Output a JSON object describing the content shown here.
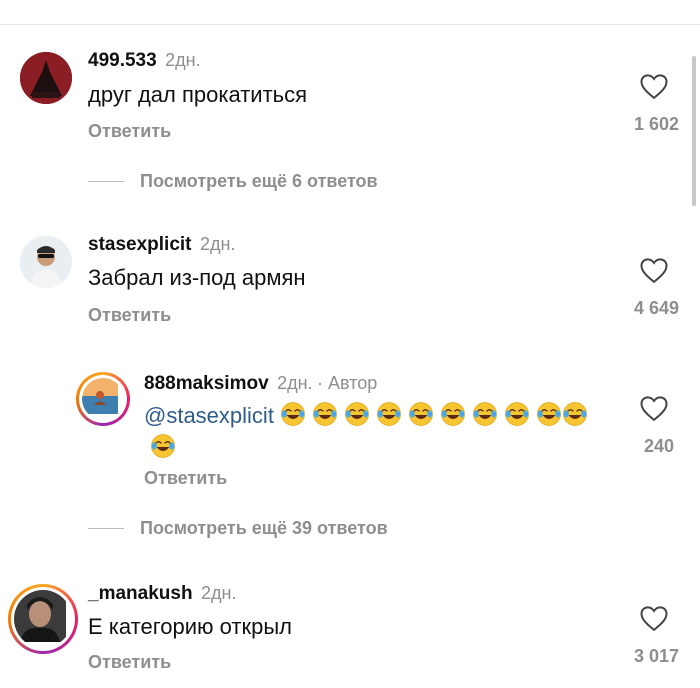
{
  "comments": [
    {
      "username": "499.533",
      "time": "2дн.",
      "text": "друг дал прокатиться",
      "reply_label": "Ответить",
      "likes": "1 602",
      "avatar_icon": "avatar-dark-red-icon"
    },
    {
      "username": "stasexplicit",
      "time": "2дн.",
      "text": "Забрал из-под армян",
      "reply_label": "Ответить",
      "likes": "4 649",
      "avatar_icon": "avatar-man-sunglasses-icon"
    },
    {
      "username": "888maksimov",
      "time": "2дн.",
      "author_label": "· Автор",
      "mention": "@stasexplicit",
      "emoji_icon": "face-with-tears-of-joy-icon",
      "emoji_count": 11,
      "reply_label": "Ответить",
      "likes": "240"
    },
    {
      "username": "_manakush",
      "time": "2дн.",
      "text": "Е категорию открыл",
      "reply_label": "Ответить",
      "likes": "3 017"
    }
  ],
  "view_more": [
    {
      "label": "Посмотреть ещё 6 ответов"
    },
    {
      "label": "Посмотреть ещё 39 ответов"
    }
  ],
  "colors": {
    "text": "#111111",
    "secondary": "#8e8e8e",
    "mention": "#2f5d8a"
  }
}
